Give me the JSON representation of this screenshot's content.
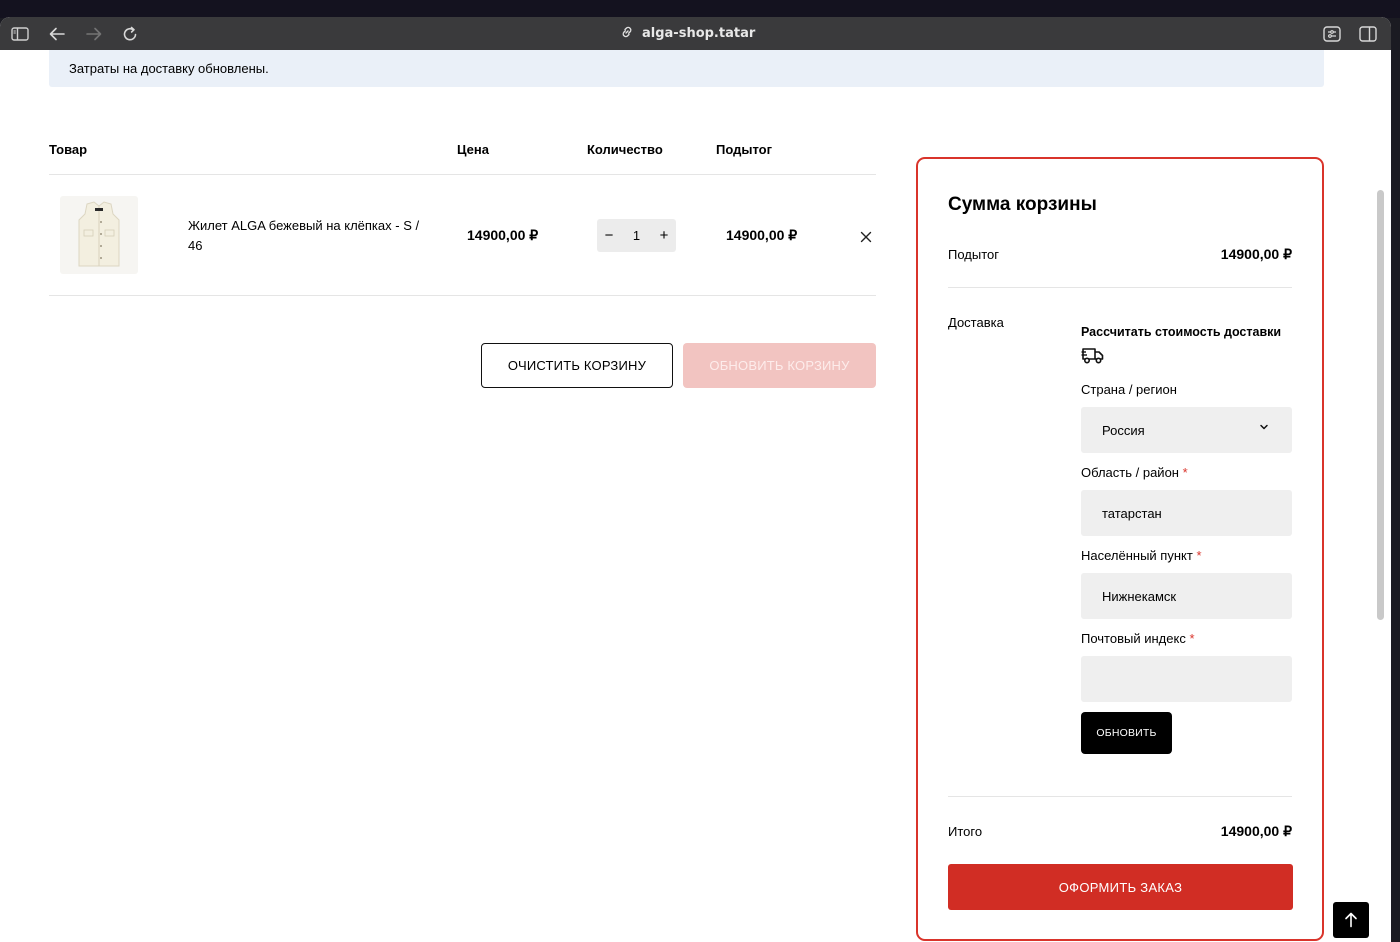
{
  "browser": {
    "url": "alga-shop.tatar"
  },
  "notice": {
    "text": "Затраты на доставку обновлены."
  },
  "cart_table": {
    "headers": {
      "product": "Товар",
      "price": "Цена",
      "quantity": "Количество",
      "subtotal": "Подытог"
    },
    "items": [
      {
        "name": "Жилет ALGA бежевый на клёпках - S / 46",
        "price": "14900,00 ₽",
        "quantity": "1",
        "subtotal": "14900,00 ₽",
        "qty_minus": "−",
        "qty_plus": "+"
      }
    ]
  },
  "cart_actions": {
    "clear_label": "ОЧИСТИТЬ КОРЗИНУ",
    "update_label": "ОБНОВИТЬ КОРЗИНУ"
  },
  "totals": {
    "title": "Сумма корзины",
    "subtotal_label": "Подытог",
    "subtotal_value": "14900,00 ₽",
    "shipping_label": "Доставка",
    "calc_label": "Рассчитать стоимость доставки",
    "country_label": "Страна / регион",
    "country_value": "Россия",
    "region_label": "Область / район",
    "region_value": "татарстан",
    "city_label": "Населённый пункт",
    "city_value": "Нижнекамск",
    "postcode_label": "Почтовый индекс",
    "postcode_value": "",
    "required_mark": "*",
    "update_button": "ОБНОВИТЬ",
    "total_label": "Итого",
    "total_value": "14900,00 ₽",
    "checkout_button": "ОФОРМИТЬ ЗАКАЗ"
  },
  "colors": {
    "accent": "#d12d24",
    "notice_bg": "#eaf0f8",
    "disabled_button": "#f2c4c1"
  },
  "icons": [
    "sidebar-icon",
    "back-arrow-icon",
    "forward-arrow-icon",
    "reload-icon",
    "link-icon",
    "reader-icon",
    "split-view-icon",
    "close-icon",
    "truck-icon",
    "chevron-down-icon",
    "arrow-up-icon"
  ]
}
